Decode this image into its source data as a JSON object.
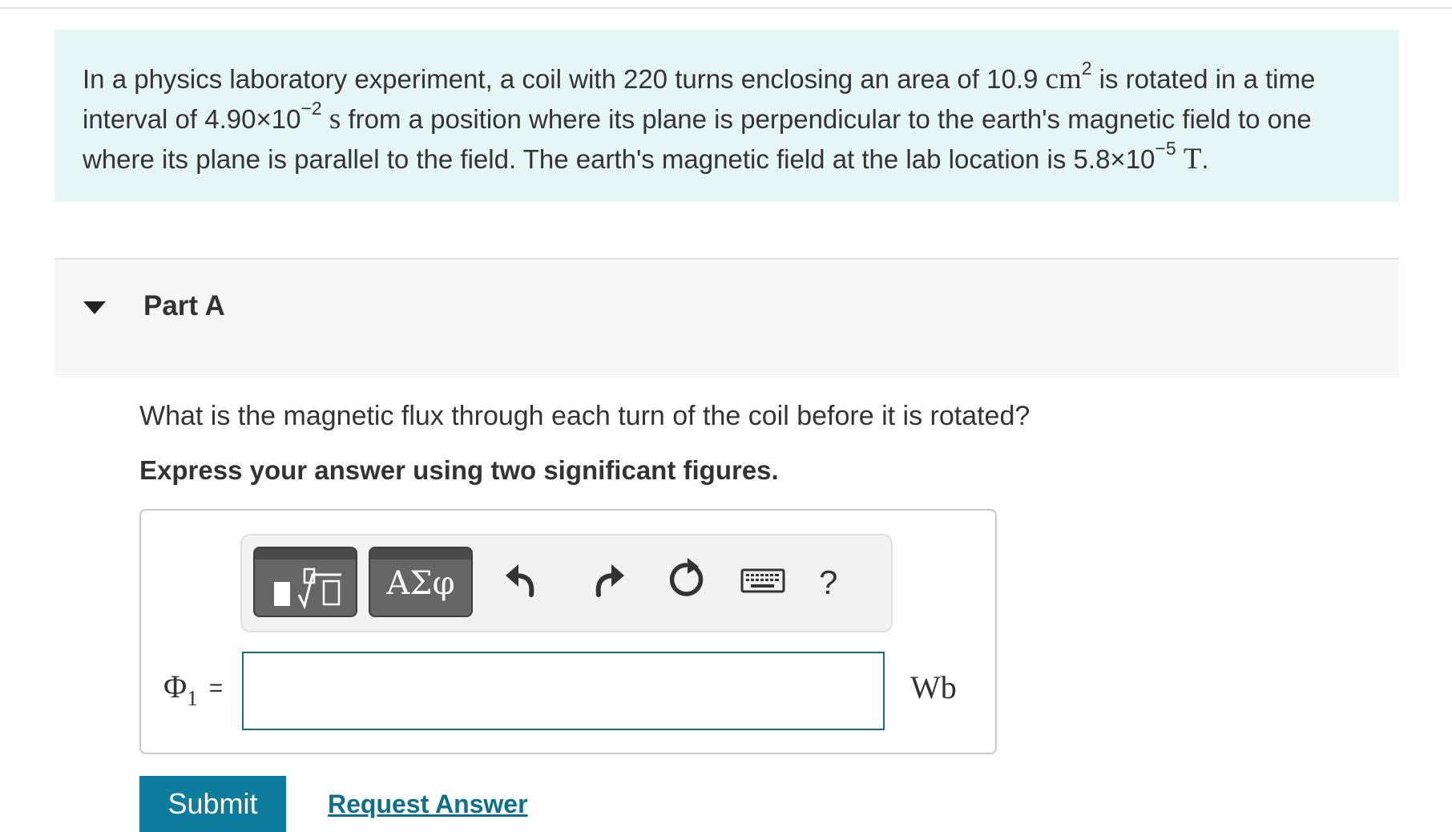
{
  "problem": {
    "t1": "In a physics laboratory experiment, a coil with 220 turns enclosing an area of 10.9",
    "area_unit": "cm",
    "area_exp": "2",
    "t2": " is rotated in a time interval of 4.90×10",
    "time_exp": "−2",
    "time_unit": "s",
    "t3": " from a position where its plane is perpendicular to the earth's magnetic field to one where its plane is parallel to the field. The earth's magnetic field at the lab location is 5.8×10",
    "field_exp": "−5",
    "field_unit": "T",
    "t4": "."
  },
  "part": {
    "title": "Part A",
    "question": "What is the magnetic flux through each turn of the coil before it is rotated?",
    "instruction": "Express your answer using two significant figures."
  },
  "toolbar": {
    "templates_icon": "templates-sqrt-icon",
    "greek_label": "ΑΣφ",
    "undo_icon": "undo-icon",
    "redo_icon": "redo-icon",
    "reset_icon": "reset-icon",
    "keyboard_icon": "keyboard-icon",
    "help_label": "?"
  },
  "answer": {
    "variable": "Φ",
    "subscript": "1",
    "equals": "=",
    "value": "",
    "unit": "Wb"
  },
  "actions": {
    "submit_label": "Submit",
    "request_label": "Request Answer"
  },
  "colors": {
    "problem_bg": "#e6f5f5",
    "accent": "#0e7c9c",
    "link": "#0e6f8c",
    "input_border": "#1a6e84"
  }
}
